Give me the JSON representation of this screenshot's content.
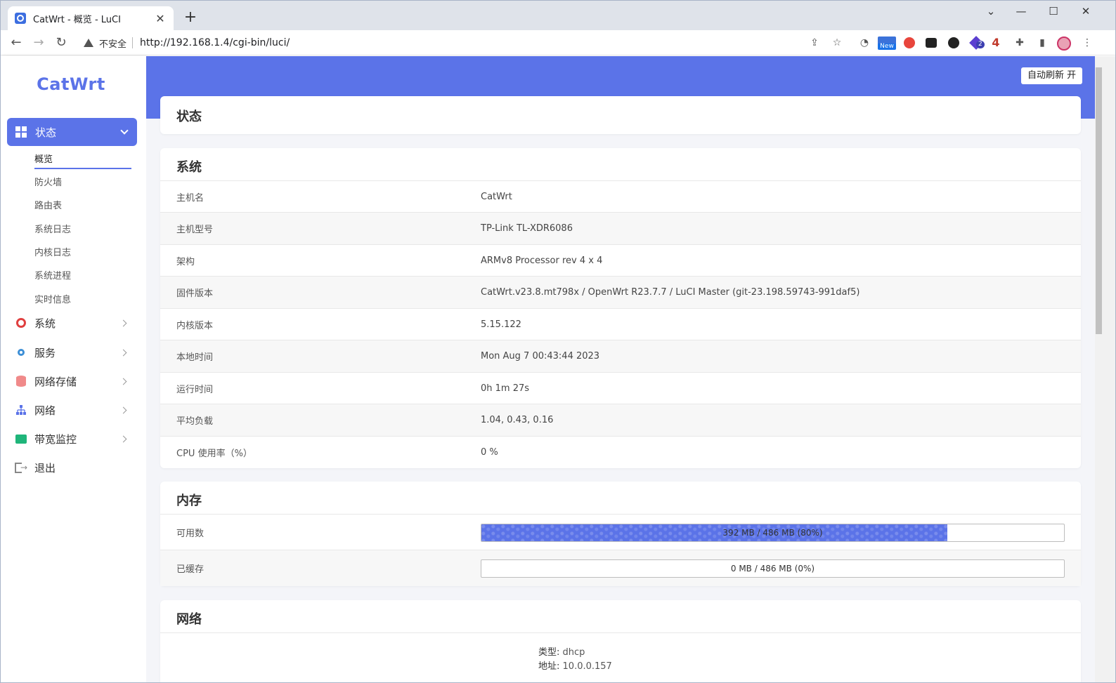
{
  "browser": {
    "tab_title": "CatWrt - 概览 - LuCI",
    "insecure_label": "不安全",
    "url": "http://192.168.1.4/cgi-bin/luci/",
    "ext_new_badge": "New",
    "ext_count_2": "2",
    "ext_count_4": "4"
  },
  "sidebar": {
    "logo": "CatWrt",
    "status_label": "状态",
    "submenu": [
      "概览",
      "防火墙",
      "路由表",
      "系统日志",
      "内核日志",
      "系统进程",
      "实时信息"
    ],
    "menu": [
      {
        "label": "系统",
        "icon": "gear-icon"
      },
      {
        "label": "服务",
        "icon": "cogs-icon"
      },
      {
        "label": "网络存储",
        "icon": "database-icon"
      },
      {
        "label": "网络",
        "icon": "sitemap-icon"
      },
      {
        "label": "带宽监控",
        "icon": "monitor-icon"
      },
      {
        "label": "退出",
        "icon": "logout-icon"
      }
    ]
  },
  "header": {
    "refresh_button": "自动刷新 开",
    "page_title": "状态"
  },
  "system": {
    "title": "系统",
    "rows": [
      {
        "key": "主机名",
        "value": "CatWrt"
      },
      {
        "key": "主机型号",
        "value": "TP-Link TL-XDR6086"
      },
      {
        "key": "架构",
        "value": "ARMv8 Processor rev 4 x 4"
      },
      {
        "key": "固件版本",
        "value": "CatWrt.v23.8.mt798x / OpenWrt R23.7.7 / LuCI Master (git-23.198.59743-991daf5)"
      },
      {
        "key": "内核版本",
        "value": "5.15.122"
      },
      {
        "key": "本地时间",
        "value": "Mon Aug 7 00:43:44 2023"
      },
      {
        "key": "运行时间",
        "value": "0h 1m 27s"
      },
      {
        "key": "平均负载",
        "value": "1.04, 0.43, 0.16"
      },
      {
        "key": "CPU 使用率（%）",
        "value": "0 %"
      }
    ]
  },
  "memory": {
    "title": "内存",
    "rows": [
      {
        "key": "可用数",
        "text": "392 MB / 486 MB (80%)",
        "percent": 80
      },
      {
        "key": "已缓存",
        "text": "0 MB / 486 MB (0%)",
        "percent": 0
      }
    ]
  },
  "network": {
    "title": "网络",
    "type_key": "类型:",
    "type_value": "dhcp",
    "addr_key": "地址:",
    "addr_value": "10.0.0.157"
  },
  "colors": {
    "accent": "#5b73e8"
  }
}
